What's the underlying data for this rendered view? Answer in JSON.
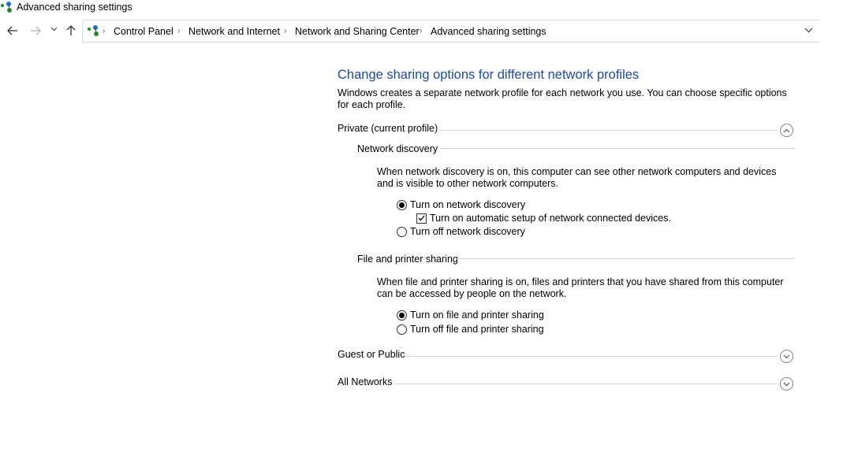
{
  "window": {
    "title": "Advanced sharing settings"
  },
  "nav": {
    "back_icon": "arrow-left-icon",
    "forward_icon": "arrow-right-icon",
    "recent_icon": "chevron-down-icon",
    "up_icon": "arrow-up-icon"
  },
  "breadcrumb": {
    "items": [
      "Control Panel",
      "Network and Internet",
      "Network and Sharing Center",
      "Advanced sharing settings"
    ],
    "separator": "›"
  },
  "page": {
    "title": "Change sharing options for different network profiles",
    "intro": "Windows creates a separate network profile for each network you use. You can choose specific options for each profile."
  },
  "profiles": {
    "private": {
      "label": "Private (current profile)",
      "expanded": true,
      "network_discovery": {
        "label": "Network discovery",
        "description": "When network discovery is on, this computer can see other network computers and devices and is visible to other network computers.",
        "on_label": "Turn on network discovery",
        "auto_setup_label": "Turn on automatic setup of network connected devices.",
        "off_label": "Turn off network discovery",
        "selected": "on",
        "auto_setup_checked": true
      },
      "file_printer_sharing": {
        "label": "File and printer sharing",
        "description": "When file and printer sharing is on, files and printers that you have shared from this computer can be accessed by people on the network.",
        "on_label": "Turn on file and printer sharing",
        "off_label": "Turn off file and printer sharing",
        "selected": "on"
      }
    },
    "guest": {
      "label": "Guest or Public",
      "expanded": false
    },
    "all": {
      "label": "All Networks",
      "expanded": false
    }
  },
  "colors": {
    "title_blue": "#1e4b9c",
    "rule": "#d5d5d5"
  }
}
